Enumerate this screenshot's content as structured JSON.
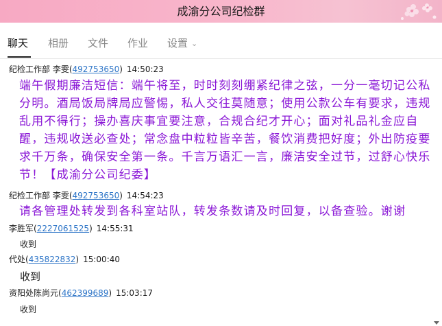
{
  "window": {
    "title": "成渝分公司纪检群"
  },
  "tabs": [
    "聊天",
    "相册",
    "文件",
    "作业",
    "设置"
  ],
  "messages": [
    {
      "sender": "纪检工作部 李雯",
      "qq": "492753650",
      "time": "14:50:23",
      "text": "端午假期廉洁短信：端午将至，时时刻刻绷紧纪律之弦，一分一毫切记公私分明。酒局饭局牌局应警惕，私人交往莫随意；使用公款公车有要求，违规乱用不得行；操办喜庆事宜要注意，合规合纪才开心；面对礼品礼金应自醒，违规收送必查处；常念盘中粒粒皆辛苦，餐饮消费把好度；外出防疫要求千万条，确保安全第一条。千言万语汇一言，廉洁安全过节，过舒心快乐节！【成渝分公司纪委】"
    },
    {
      "sender": "纪检工作部 李雯",
      "qq": "492753650",
      "time": "14:54:23",
      "text": "请各管理处转发到各科室站队，转发条数请及时回复，以备查验。谢谢"
    },
    {
      "sender": "李胜军",
      "qq": "2227061525",
      "time": "14:55:31",
      "text": "收到"
    },
    {
      "sender": "代处",
      "qq": "435822832",
      "time": "15:00:40",
      "text": "收到"
    },
    {
      "sender": "资阳处陈尚元",
      "qq": "462399689",
      "time": "15:03:17",
      "text": "收到"
    }
  ],
  "colors": {
    "titlebar": "#f8b7cc",
    "notice_text": "#8a17d6",
    "qq_link": "#2c74c7"
  }
}
